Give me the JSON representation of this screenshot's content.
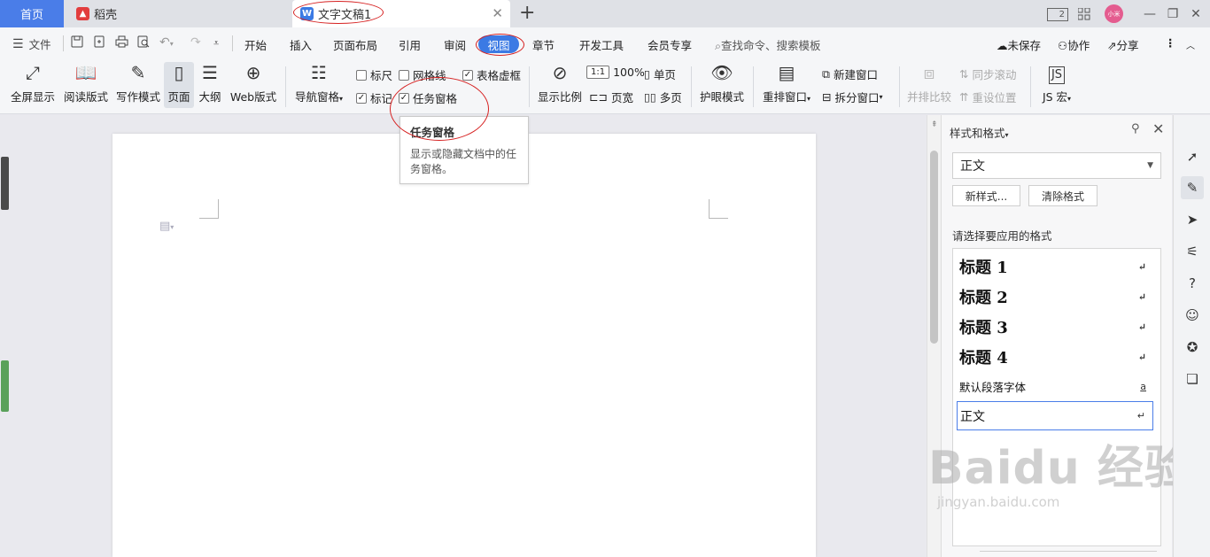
{
  "titlebar": {
    "home_tab": "首页",
    "tabs": [
      {
        "label": "稻壳"
      },
      {
        "label": "文字文稿1"
      }
    ],
    "close_glyph": "✕",
    "add_glyph": "+",
    "layout_badge": "2",
    "avatar_text": "小米"
  },
  "menubar": {
    "file": "文件",
    "items": [
      "开始",
      "插入",
      "页面布局",
      "引用",
      "审阅",
      "视图",
      "章节",
      "开发工具",
      "会员专享"
    ],
    "search_placeholder": "查找命令、搜索模板",
    "unsaved": "未保存",
    "collaborate": "协作",
    "share": "分享"
  },
  "ribbon": {
    "fullscreen": "全屏显示",
    "reading": "阅读版式",
    "writing": "写作模式",
    "page": "页面",
    "outline": "大纲",
    "web": "Web版式",
    "nav_pane": "导航窗格",
    "ruler": "标尺",
    "gridlines": "网格线",
    "table_gridlines": "表格虚框",
    "marks": "标记",
    "task_pane": "任务窗格",
    "zoom_ratio": "显示比例",
    "zoom_100": "100%",
    "one_page": "单页",
    "page_width": "页宽",
    "multi_page": "多页",
    "eye_protect": "护眼模式",
    "rearrange": "重排窗口",
    "new_window": "新建窗口",
    "split_window": "拆分窗口",
    "side_by_side": "并排比较",
    "sync_scroll": "同步滚动",
    "reset_position": "重设位置",
    "js_macro": "JS 宏",
    "ruler_checked": false,
    "gridlines_checked": false,
    "table_gridlines_checked": true,
    "marks_checked": true,
    "task_pane_checked": true
  },
  "tooltip": {
    "title": "任务窗格",
    "description": "显示或隐藏文档中的任务窗格。"
  },
  "pane": {
    "title": "样式和格式",
    "current_style": "正文",
    "new_style_button": "新样式...",
    "clear_format_button": "清除格式",
    "subtitle": "请选择要应用的格式",
    "styles": [
      {
        "label": "标题  1",
        "mark": "↵"
      },
      {
        "label": "标题  2",
        "mark": "↵"
      },
      {
        "label": "标题  3",
        "mark": "↵"
      },
      {
        "label": "标题  4",
        "mark": "↵"
      },
      {
        "label": "默认段落字体",
        "mark": "a"
      },
      {
        "label": "正文",
        "mark": "↵"
      }
    ]
  },
  "watermark": {
    "big": "Baidu 经验",
    "small": "jingyan.baidu.com"
  },
  "colors": {
    "accent": "#3b7ae4",
    "home_tab": "#4a7de8",
    "annotation": "#d62020",
    "avatar": "#e45c8f"
  },
  "icons": {
    "strip": [
      "rocket-icon",
      "pen-icon",
      "cursor-icon",
      "settings-sliders-icon",
      "help-icon",
      "bot-icon",
      "lightbulb-icon",
      "book-icon"
    ]
  }
}
